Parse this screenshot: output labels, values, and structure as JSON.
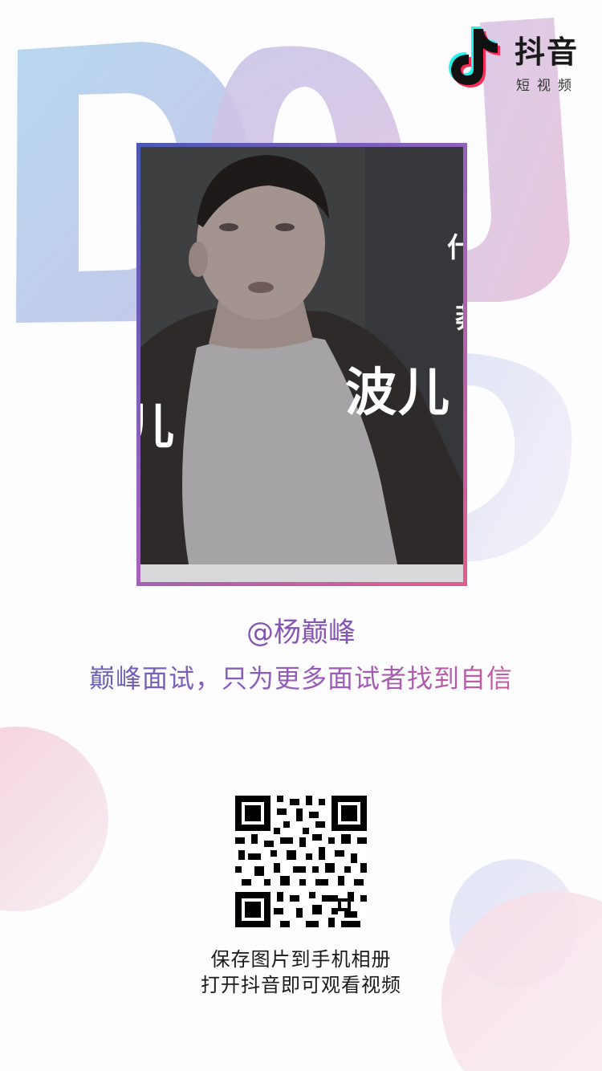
{
  "brand": {
    "name": "抖音",
    "sub": "短视频",
    "background_letters": "DOU",
    "colors": {
      "cyan": "#25f4ee",
      "pink": "#fe2c55",
      "purple": "#8455b3",
      "blue": "#5564b8"
    }
  },
  "video": {
    "caption_main": "波儿",
    "caption_line1": "什",
    "caption_line2": "莽",
    "caption_left": "儿"
  },
  "profile": {
    "handle": "@杨巅峰",
    "slogan": "巅峰面试，只为更多面试者找到自信"
  },
  "qr": {
    "icon": "qr-code-icon"
  },
  "instructions": {
    "line1": "保存图片到手机相册",
    "line2": "打开抖音即可观看视频"
  }
}
